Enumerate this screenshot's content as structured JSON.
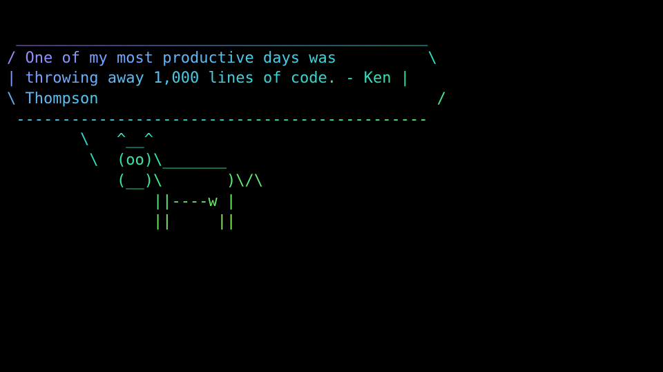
{
  "cowsay": {
    "lines": [
      " _____________________________________________",
      "/ One of my most productive days was          \\",
      "| throwing away 1,000 lines of code. - Ken |",
      "\\ Thompson                                     /",
      " ---------------------------------------------",
      "        \\   ^__^",
      "         \\  (oo)\\_______",
      "            (__)\\       )\\/\\",
      "                ||----w |",
      "                ||     ||"
    ],
    "quote_text": "One of my most productive days was throwing away 1,000 lines of code.",
    "quote_author": "Ken Thompson",
    "gradient_stops": [
      "#b47cff",
      "#7c9dff",
      "#4fc8e8",
      "#2fd9c8",
      "#3de89a",
      "#68e86a",
      "#9fef4f",
      "#c8f53e"
    ]
  }
}
